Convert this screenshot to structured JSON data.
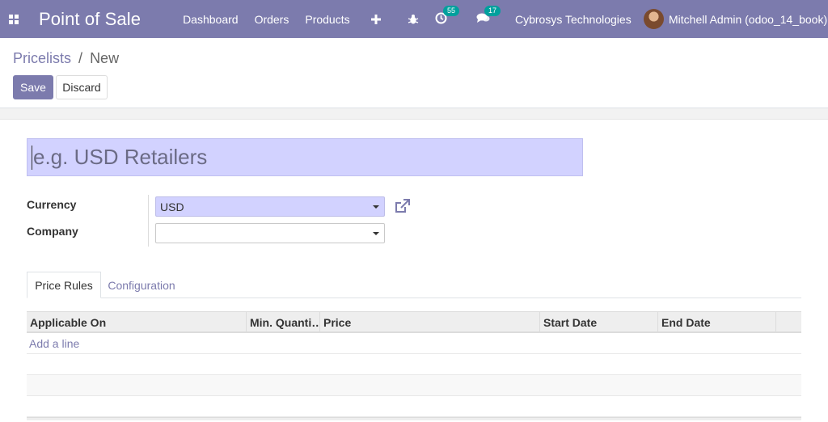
{
  "navbar": {
    "app_title": "Point of Sale",
    "menu": [
      "Dashboard",
      "Orders",
      "Products"
    ],
    "activity_badge": "55",
    "messages_badge": "17",
    "company": "Cybrosys Technologies",
    "user": "Mitchell Admin (odoo_14_book)",
    "color": "#7c7bad"
  },
  "breadcrumb": {
    "parent": "Pricelists",
    "separator": "/",
    "current": "New"
  },
  "buttons": {
    "save": "Save",
    "discard": "Discard"
  },
  "form": {
    "name_placeholder": "e.g. USD Retailers",
    "currency_label": "Currency",
    "currency_value": "USD",
    "company_label": "Company",
    "company_value": ""
  },
  "tabs": [
    "Price Rules",
    "Configuration"
  ],
  "table": {
    "columns": [
      "Applicable On",
      "Min. Quanti…",
      "Price",
      "Start Date",
      "End Date"
    ],
    "add_line": "Add a line"
  },
  "icons": {
    "apps": "apps-grid-icon",
    "plus": "plus-icon",
    "debug": "bug-icon",
    "activity": "clock-icon",
    "messages": "chat-icon",
    "external": "external-link-icon"
  },
  "colors": {
    "accent": "#7c7bad",
    "field_highlight": "#d2d2ff",
    "badge": "#00a09d"
  }
}
